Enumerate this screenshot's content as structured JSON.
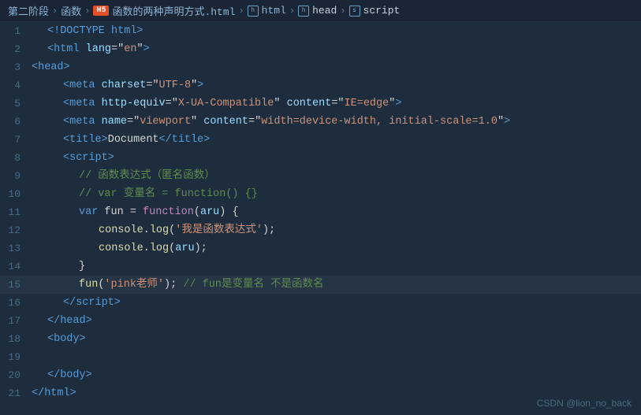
{
  "breadcrumb": {
    "items": [
      "第二阶段",
      "函数",
      "函数的两种声明方式.html",
      "html",
      "head",
      "script"
    ]
  },
  "watermark": "CSDN @lion_no_back",
  "lines": [
    {
      "num": 1,
      "type": "html",
      "content": "doctype"
    },
    {
      "num": 2,
      "type": "html",
      "content": "html_open"
    },
    {
      "num": 3,
      "type": "html",
      "content": "head_open"
    },
    {
      "num": 4,
      "type": "html",
      "content": "meta_charset"
    },
    {
      "num": 5,
      "type": "html",
      "content": "meta_compat"
    },
    {
      "num": 6,
      "type": "html",
      "content": "meta_viewport"
    },
    {
      "num": 7,
      "type": "html",
      "content": "title"
    },
    {
      "num": 8,
      "type": "html",
      "content": "script_open"
    },
    {
      "num": 9,
      "type": "js",
      "content": "comment1"
    },
    {
      "num": 10,
      "type": "js",
      "content": "comment2"
    },
    {
      "num": 11,
      "type": "js",
      "content": "var_fun"
    },
    {
      "num": 12,
      "type": "js",
      "content": "console1"
    },
    {
      "num": 13,
      "type": "js",
      "content": "console2"
    },
    {
      "num": 14,
      "type": "js",
      "content": "brace"
    },
    {
      "num": 15,
      "type": "js",
      "content": "fun_call"
    },
    {
      "num": 16,
      "type": "html",
      "content": "script_close"
    },
    {
      "num": 17,
      "type": "html",
      "content": "head_close"
    },
    {
      "num": 18,
      "type": "html",
      "content": "body_open"
    },
    {
      "num": 19,
      "type": "empty"
    },
    {
      "num": 20,
      "type": "html",
      "content": "body_close"
    },
    {
      "num": 21,
      "type": "html",
      "content": "html_close"
    }
  ]
}
